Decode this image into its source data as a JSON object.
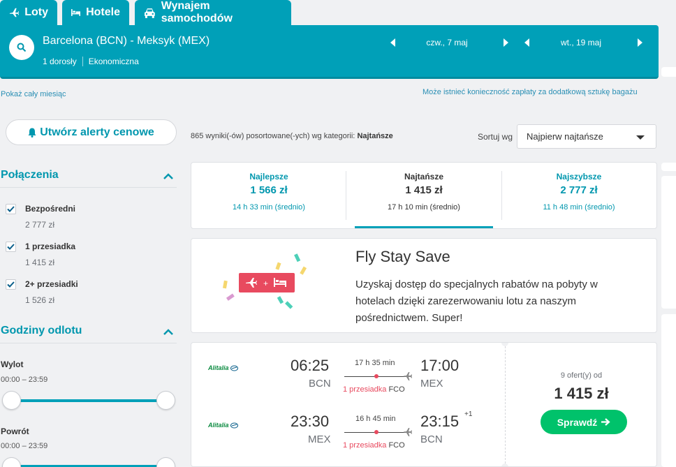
{
  "tabs": [
    {
      "label": "Loty",
      "icon": "plane-icon"
    },
    {
      "label": "Hotele",
      "icon": "bed-icon"
    },
    {
      "label": "Wynajem samochodów",
      "icon": "car-icon"
    }
  ],
  "search": {
    "route": "Barcelona (BCN) - Meksyk (MEX)",
    "travellers": "1 dorosły",
    "cabin": "Ekonomiczna",
    "depart_date": "czw., 7 maj",
    "return_date": "wt., 19 maj"
  },
  "links": {
    "whole_month": "Pokaż cały miesiąc",
    "baggage_notice": "Może istnieć konieczność zapłaty za dodatkową sztukę bagażu"
  },
  "sidebar": {
    "alert_button": "Utwórz alerty cenowe",
    "connections_title": "Połączenia",
    "connections": [
      {
        "label": "Bezpośredni",
        "price": "2 777 zł",
        "checked": true
      },
      {
        "label": "1 przesiadka",
        "price": "1 415 zł",
        "checked": true
      },
      {
        "label": "2+ przesiadki",
        "price": "1 526 zł",
        "checked": true
      }
    ],
    "times_title": "Godziny odlotu",
    "outbound_title": "Wylot",
    "outbound_range": "00:00 – 23:59",
    "return_title": "Powrót",
    "return_range": "00:00 – 23:59"
  },
  "results": {
    "count_text": "865 wyniki(-ów) posortowane(-ych) wg kategorii:",
    "count_category": "Najtańsze",
    "sort_label": "Sortuj wg",
    "sort_value": "Najpierw najtańsze"
  },
  "sort_tabs": [
    {
      "title": "Najlepsze",
      "price": "1 566 zł",
      "duration": "14 h 33 min (średnio)",
      "active": false
    },
    {
      "title": "Najtańsze",
      "price": "1 415 zł",
      "duration": "17 h 10 min (średnio)",
      "active": true
    },
    {
      "title": "Najszybsze",
      "price": "2 777 zł",
      "duration": "11 h 48 min (średnio)",
      "active": false
    }
  ],
  "promo": {
    "title": "Fly Stay Save",
    "text": "Uzyskaj dostęp do specjalnych rabatów na pobyty w hotelach dzięki zarezerwowaniu lotu za naszym pośrednictwem. Super!"
  },
  "flight": {
    "airline": "Alitalia",
    "legs": [
      {
        "dep_time": "06:25",
        "dep_code": "BCN",
        "duration": "17 h 35 min",
        "stops": "1 przesiadka",
        "via": "FCO",
        "arr_time": "17:00",
        "arr_code": "MEX",
        "day_offset": ""
      },
      {
        "dep_time": "23:30",
        "dep_code": "MEX",
        "duration": "16 h 45 min",
        "stops": "1 przesiadka",
        "via": "FCO",
        "arr_time": "23:15",
        "arr_code": "BCN",
        "day_offset": "+1"
      }
    ],
    "offers": "9 ofert(y) od",
    "price": "1 415 zł",
    "button": "Sprawdź"
  },
  "colors": {
    "accent": "#00a0b8",
    "green": "#00c26b",
    "red": "#e84a5f"
  }
}
